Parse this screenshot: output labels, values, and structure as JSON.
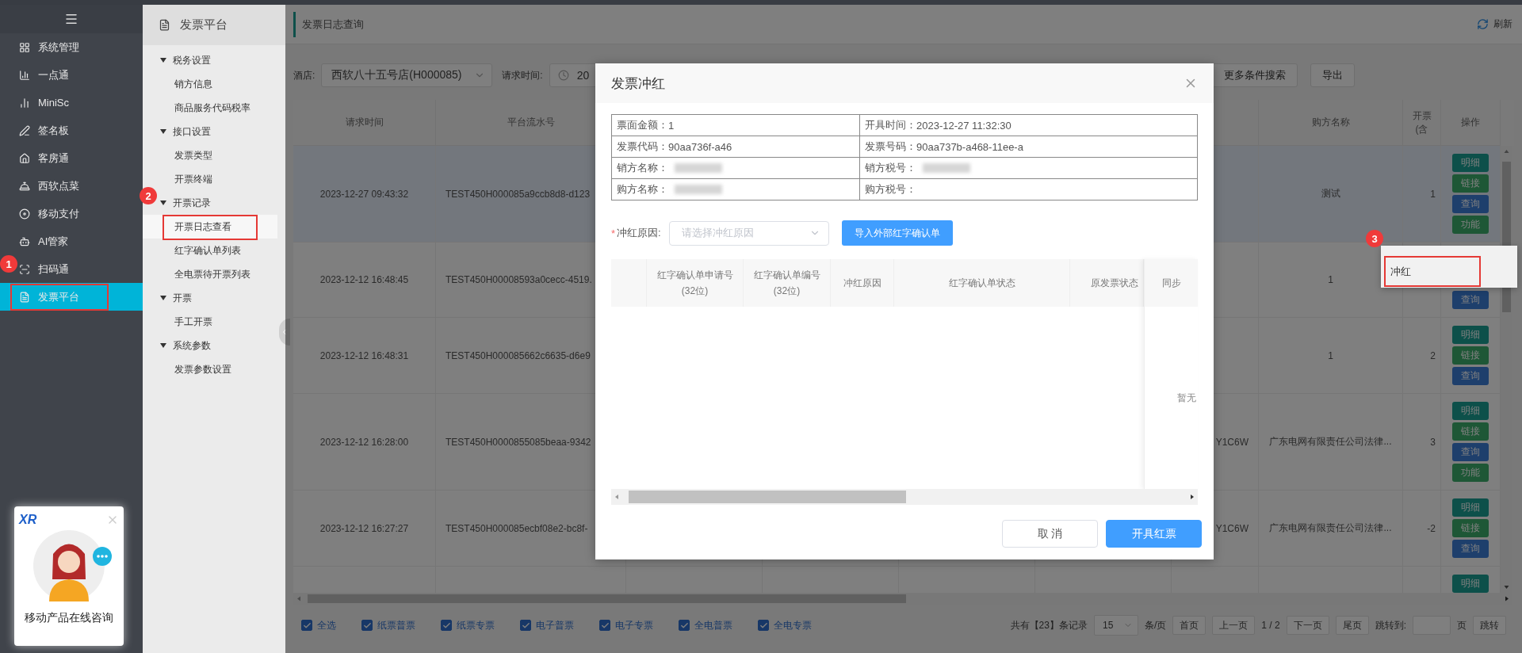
{
  "nav": {
    "items": [
      {
        "label": "系统管理",
        "selected": false,
        "highlighted": false
      },
      {
        "label": "一点通",
        "selected": false,
        "highlighted": false
      },
      {
        "label": "MiniSc",
        "selected": false,
        "highlighted": false
      },
      {
        "label": "签名板",
        "selected": false,
        "highlighted": false
      },
      {
        "label": "客房通",
        "selected": false,
        "highlighted": false
      },
      {
        "label": "西软点菜",
        "selected": false,
        "highlighted": false
      },
      {
        "label": "移动支付",
        "selected": false,
        "highlighted": false
      },
      {
        "label": "AI管家",
        "selected": false,
        "highlighted": false
      },
      {
        "label": "扫码通",
        "selected": false,
        "highlighted": false
      },
      {
        "label": "发票平台",
        "selected": true,
        "highlighted": true,
        "badge": "1"
      }
    ]
  },
  "chat_widget": {
    "logo": "XR",
    "label": "移动产品在线咨询"
  },
  "submenu": {
    "title": "发票平台",
    "groups": [
      {
        "label": "税务设置",
        "expanded": true,
        "children": [
          {
            "label": "销方信息",
            "selected": false,
            "highlighted": false
          },
          {
            "label": "商品服务代码税率",
            "selected": false,
            "highlighted": false
          }
        ]
      },
      {
        "label": "接口设置",
        "expanded": true,
        "children": [
          {
            "label": "发票类型",
            "selected": false,
            "highlighted": false
          },
          {
            "label": "开票终端",
            "selected": false,
            "highlighted": false
          }
        ]
      },
      {
        "label": "开票记录",
        "expanded": true,
        "children": [
          {
            "label": "开票日志查看",
            "selected": true,
            "highlighted": true,
            "badge": "2"
          },
          {
            "label": "红字确认单列表",
            "selected": false,
            "highlighted": false
          },
          {
            "label": "全电票待开票列表",
            "selected": false,
            "highlighted": false
          }
        ]
      },
      {
        "label": "开票",
        "expanded": true,
        "children": [
          {
            "label": "手工开票",
            "selected": false,
            "highlighted": false
          }
        ]
      },
      {
        "label": "系统参数",
        "expanded": true,
        "children": [
          {
            "label": "发票参数设置",
            "selected": false,
            "highlighted": false
          }
        ]
      }
    ]
  },
  "page": {
    "title": "发票日志查询",
    "refresh": "刷新"
  },
  "filters": {
    "hotel_label": "酒店:",
    "hotel": "西软八十五号店(H000085)",
    "time_label": "请求时间:",
    "time_value": "20",
    "buttons": [
      "更多条件搜索",
      "导出"
    ]
  },
  "table": {
    "columns": [
      "请求时间",
      "平台流水号",
      "购方名称",
      "开票\n(含",
      "操作"
    ],
    "rows": [
      {
        "selected": true,
        "time": "2023-12-27 09:43:32",
        "serial": "TEST450H000085a9ccb8d8-d123",
        "buyer": "测试",
        "amount": "1",
        "ops": [
          {
            "label": "明细",
            "kind": "detail"
          },
          {
            "label": "链接",
            "kind": "link"
          },
          {
            "label": "查询",
            "kind": "query"
          },
          {
            "label": "功能",
            "kind": "function"
          }
        ]
      },
      {
        "selected": false,
        "time": "2023-12-12 16:48:45",
        "serial": "TEST450H00008593a0cecc-4519.",
        "buyer": "1",
        "ops": [
          {
            "label": "查询",
            "kind": "query"
          }
        ]
      },
      {
        "selected": false,
        "time": "2023-12-12 16:48:31",
        "serial": "TEST450H000085662c6635-d6e9",
        "buyer": "1",
        "amount": "2",
        "ops": [
          {
            "label": "明细",
            "kind": "detail"
          },
          {
            "label": "链接",
            "kind": "link"
          },
          {
            "label": "查询",
            "kind": "query"
          }
        ]
      },
      {
        "selected": false,
        "time": "2023-12-12 16:28:00",
        "serial": "TEST450H0000855085beaa-9342",
        "column_3": "Y1C6W",
        "buyer": "广东电网有限责任公司法律...",
        "amount": "3",
        "ops": [
          {
            "label": "明细",
            "kind": "detail"
          },
          {
            "label": "链接",
            "kind": "link"
          },
          {
            "label": "查询",
            "kind": "query"
          },
          {
            "label": "功能",
            "kind": "function"
          }
        ]
      },
      {
        "selected": false,
        "time": "2023-12-12 16:27:27",
        "serial": "TEST450H000085ecbf08e2-bc8f-",
        "column_3": "Y1C6W",
        "buyer": "广东电网有限责任公司法律...",
        "amount": "-2",
        "ops": [
          {
            "label": "明细",
            "kind": "detail"
          },
          {
            "label": "链接",
            "kind": "link"
          },
          {
            "label": "查询",
            "kind": "query"
          }
        ]
      },
      {
        "selected": false,
        "ops": [
          {
            "label": "明细",
            "kind": "detail"
          }
        ]
      }
    ]
  },
  "footer": {
    "types": [
      {
        "label": "全选",
        "checked": true
      },
      {
        "label": "纸票普票",
        "checked": true
      },
      {
        "label": "纸票专票",
        "checked": true
      },
      {
        "label": "电子普票",
        "checked": true
      },
      {
        "label": "电子专票",
        "checked": true
      },
      {
        "label": "全电普票",
        "checked": true
      },
      {
        "label": "全电专票",
        "checked": true
      }
    ],
    "pagination": {
      "total": "共有【23】条记录",
      "page_size": "15",
      "per_page": "条/页",
      "first": "首页",
      "prev": "上一页",
      "current": "1 / 2",
      "next": "下一页",
      "last": "尾页",
      "jump_label": "跳转到:",
      "page_unit": "页",
      "jump": "跳转"
    }
  },
  "context_menu": {
    "items": [
      {
        "label": "冲红",
        "highlighted": true,
        "badge": "3"
      }
    ]
  },
  "dialog": {
    "title": "发票冲红",
    "info": [
      {
        "label": "票面金额：",
        "value": "1",
        "redacted": false
      },
      {
        "label": "开具时间：",
        "value": "2023-12-27 11:32:30",
        "redacted": false
      },
      {
        "label": "发票代码：",
        "value": "90aa736f-a46",
        "redacted": false
      },
      {
        "label": "发票号码：",
        "value": "90aa737b-a468-11ee-a",
        "redacted": false
      },
      {
        "label": "销方名称：",
        "redacted": true
      },
      {
        "label": "销方税号：",
        "redacted": true
      },
      {
        "label": "购方名称：",
        "redacted": true
      },
      {
        "label": "购方税号：",
        "redacted": false
      }
    ],
    "reason": {
      "required_mark": "*",
      "label": "冲红原因:",
      "placeholder": "请选择冲红原因"
    },
    "import_button": "导入外部红字确认单",
    "columns": [
      "红字确认单申请号(32位)",
      "红字确认单编号(32位)",
      "冲红原因",
      "红字确认单状态",
      "原发票状态"
    ],
    "fixed_column": "同步",
    "empty_text": "暂无",
    "buttons": [
      {
        "label": "取 消",
        "kind": "secondary"
      },
      {
        "label": "开具红票",
        "kind": "primary"
      }
    ]
  }
}
